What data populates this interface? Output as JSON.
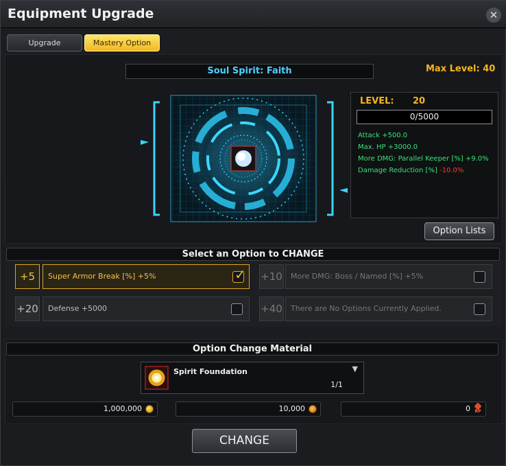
{
  "window": {
    "title": "Equipment Upgrade"
  },
  "tabs": [
    {
      "label": "Upgrade",
      "active": false
    },
    {
      "label": "Mastery Option",
      "active": true
    }
  ],
  "soul": {
    "name": "Soul Spirit: Faith",
    "max_level": "Max Level: 40"
  },
  "stats": {
    "level_label": "LEVEL:",
    "level_value": "20",
    "exp": "0/5000",
    "exp_fraction": 0,
    "lines": [
      {
        "label": "Attack +500.0",
        "negative": ""
      },
      {
        "label": "Max. HP +3000.0",
        "negative": ""
      },
      {
        "label": "More DMG: Parallel Keeper [%] +9.0%",
        "negative": ""
      },
      {
        "label": "Damage Reduction [%] ",
        "negative": "-10.0%"
      }
    ]
  },
  "option_lists_label": "Option Lists",
  "select_header": "Select an Option to CHANGE",
  "options": [
    {
      "num": "+5",
      "label": "Super Armor Break [%] +5%",
      "checked": true,
      "enabled": true
    },
    {
      "num": "+10",
      "label": "More DMG: Boss / Named [%] +5%",
      "checked": false,
      "enabled": false
    },
    {
      "num": "+20",
      "label": "Defense +5000",
      "checked": false,
      "enabled": true
    },
    {
      "num": "+40",
      "label": "There are No Options Currently Applied.",
      "checked": false,
      "enabled": false
    }
  ],
  "material_header": "Option Change Material",
  "material": {
    "name": "Spirit Foundation",
    "count": "1/1",
    "dropdown_icon": "triangle-down-icon"
  },
  "costs": [
    {
      "value": "1,000,000",
      "icon": "gold-coin-icon"
    },
    {
      "value": "10,000",
      "icon": "orange-coin-icon"
    },
    {
      "value": "0",
      "icon": "rp-icon",
      "icon_text": "RP"
    }
  ],
  "change_label": "CHANGE",
  "colors": {
    "accent": "#f5b51e",
    "cyan": "#4ed0ff",
    "stat_green": "#3be37a",
    "negative": "#ff3b30"
  }
}
